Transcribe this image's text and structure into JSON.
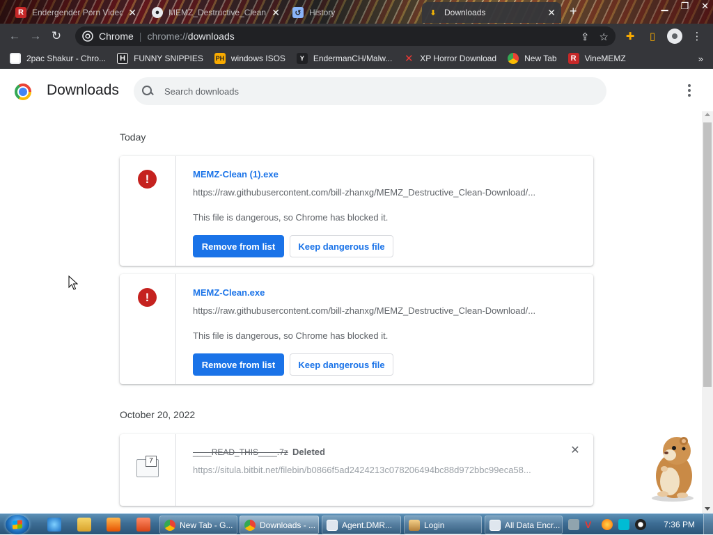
{
  "browser": {
    "tabs": [
      {
        "title": "Endergender Porn Video...",
        "favicon": "r-logo-icon",
        "active": false
      },
      {
        "title": "MEMZ_Destructive_Clean...",
        "favicon": "github-icon",
        "active": false
      },
      {
        "title": "History",
        "favicon": "history-icon",
        "active": false
      },
      {
        "title": "Downloads",
        "favicon": "download-icon",
        "active": true
      }
    ],
    "new_tab_symbol": "+",
    "omnibox": {
      "site_label": "Chrome",
      "url_scheme": "chrome://",
      "url_host": "downloads"
    },
    "bookmarks": [
      {
        "label": "2pac Shakur - Chro...",
        "icon": "bookmark-favicon"
      },
      {
        "label": "FUNNY SNIPPIES",
        "icon": "h-icon"
      },
      {
        "label": "windows ISOS",
        "icon": "ph-icon"
      },
      {
        "label": "EndermanCH/Malw...",
        "icon": "yp-icon"
      },
      {
        "label": "XP Horror Download",
        "icon": "x-icon"
      },
      {
        "label": "New Tab",
        "icon": "chrome-icon"
      },
      {
        "label": "VineMEMZ",
        "icon": "r-logo-icon"
      }
    ],
    "bookmarks_overflow": "»"
  },
  "downloads_page": {
    "title": "Downloads",
    "search_placeholder": "Search downloads",
    "sections": [
      {
        "date": "Today",
        "items": [
          {
            "name": "MEMZ-Clean (1).exe",
            "url": "https://raw.githubusercontent.com/bill-zhanxg/MEMZ_Destructive_Clean-Download/...",
            "description": "This file is dangerous, so Chrome has blocked it.",
            "primary_button": "Remove from list",
            "secondary_button": "Keep dangerous file"
          },
          {
            "name": "MEMZ-Clean.exe",
            "url": "https://raw.githubusercontent.com/bill-zhanxg/MEMZ_Destructive_Clean-Download/...",
            "description": "This file is dangerous, so Chrome has blocked it.",
            "primary_button": "Remove from list",
            "secondary_button": "Keep dangerous file"
          }
        ]
      },
      {
        "date": "October 20, 2022",
        "items": [
          {
            "name": "____READ_THIS____.7z",
            "status": "Deleted",
            "url": "https://situla.bitbit.net/filebin/b0866f5ad2424213c078206494bc88d972bbc99eca58..."
          }
        ]
      }
    ]
  },
  "taskbar": {
    "tasks": [
      {
        "label": "New Tab - G...",
        "icon": "chrome-icon",
        "active": false
      },
      {
        "label": "Downloads - ...",
        "icon": "chrome-icon",
        "active": true
      },
      {
        "label": "Agent.DMR...",
        "icon": "window-icon",
        "active": false
      },
      {
        "label": "Login",
        "icon": "login-icon",
        "active": false
      },
      {
        "label": "All Data Encr...",
        "icon": "window-icon",
        "active": false
      }
    ],
    "clock": "7:36 PM"
  },
  "colors": {
    "accent_blue": "#1a73e8",
    "danger_red": "#c5221f",
    "toolbar_dark": "#35363a"
  }
}
